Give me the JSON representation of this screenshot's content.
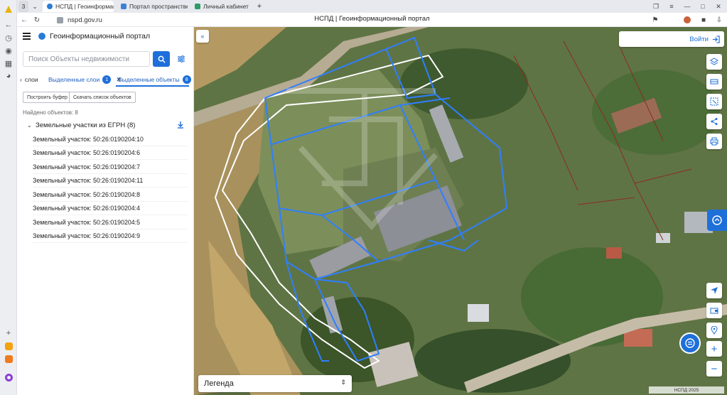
{
  "browser": {
    "tab_count": "3",
    "tabs": [
      {
        "label": "НСПД | Геоинформацио",
        "active": true
      },
      {
        "label": "Портал пространственн"
      },
      {
        "label": "Личный кабинет"
      }
    ],
    "new_tab": "+",
    "url": "nspd.gov.ru",
    "page_title": "НСПД | Геоинформационный портал"
  },
  "panel": {
    "title": "Геоинформационный портал",
    "search": {
      "placeholder": "Поиск Объекты недвижимости",
      "value": ""
    },
    "tabs": {
      "back_label": "слои",
      "layers": {
        "label": "Выделенные слои",
        "count": "1"
      },
      "objects": {
        "label": "Выделенные объекты",
        "count": "8"
      }
    },
    "buttons": {
      "buffer": "Построить буфер",
      "download": "Скачать список объектов"
    },
    "found": "Найдено объектов: 8",
    "group_title": "Земельные участки из ЕГРН (8)",
    "parcels": [
      "Земельный участок: 50:26:0190204:10",
      "Земельный участок: 50:26:0190204:6",
      "Земельный участок: 50:26:0190204:7",
      "Земельный участок: 50:26:0190204:11",
      "Земельный участок: 50:26:0190204:8",
      "Земельный участок: 50:26:0190204:4",
      "Земельный участок: 50:26:0190204:5",
      "Земельный участок: 50:26:0190204:9"
    ]
  },
  "map": {
    "login": "Войти",
    "legend": "Легенда",
    "attribution": "НСПД 2025",
    "accent": "#1e6fd9"
  }
}
